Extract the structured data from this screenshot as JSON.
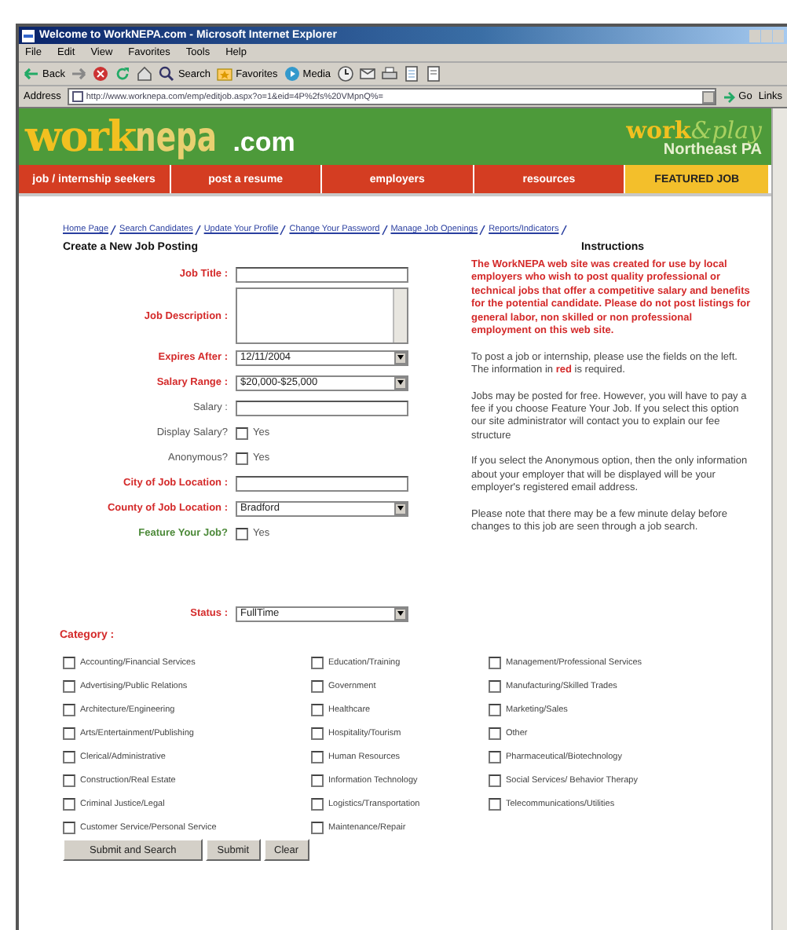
{
  "window": {
    "title": "Welcome to WorkNEPA.com - Microsoft Internet Explorer"
  },
  "menu": [
    "File",
    "Edit",
    "View",
    "Favorites",
    "Tools",
    "Help"
  ],
  "toolbar": [
    {
      "kind": "back",
      "label": "Back"
    },
    {
      "kind": "forward"
    },
    {
      "kind": "stop"
    },
    {
      "kind": "refresh"
    },
    {
      "kind": "home"
    },
    {
      "kind": "search",
      "label": "Search"
    },
    {
      "kind": "favorites",
      "label": "Favorites"
    },
    {
      "kind": "media",
      "label": "Media"
    },
    {
      "kind": "history"
    },
    {
      "kind": "mail"
    },
    {
      "kind": "print"
    },
    {
      "kind": "edit"
    },
    {
      "kind": "discuss"
    }
  ],
  "address": {
    "label": "Address",
    "url": "http://www.worknepa.com/emp/editjob.aspx?o=1&eid=4P%2fs%20VMpnQ%=",
    "go": "Go",
    "links": "Links"
  },
  "banner": {
    "logo_parts": [
      "work",
      "nepa",
      ".com"
    ],
    "side_logo_parts": [
      "work",
      "&play",
      "Northeast PA"
    ]
  },
  "nav": [
    {
      "label": "job / internship seekers",
      "selected": false
    },
    {
      "label": "post a resume",
      "selected": false
    },
    {
      "label": "employers",
      "selected": false
    },
    {
      "label": "resources",
      "selected": false
    },
    {
      "label": "FEATURED JOB",
      "selected": true
    }
  ],
  "breadcrumbs": [
    "Home Page",
    "Search Candidates",
    "Update Your Profile",
    "Change Your Password",
    "Manage Job Openings",
    "Reports/Indicators"
  ],
  "form": {
    "title": "Create a New Job Posting",
    "fields": [
      {
        "label": "Job Title :",
        "kind": "text",
        "required": true
      },
      {
        "label": "Job Description :",
        "kind": "textarea",
        "required": true
      },
      {
        "label": "Expires After :",
        "kind": "select",
        "required": true,
        "value": "12/11/2004"
      },
      {
        "label": "Salary Range :",
        "kind": "select",
        "required": true,
        "value": "$20,000-$25,000"
      },
      {
        "label": "Salary :",
        "kind": "text",
        "required": false,
        "highlighted": false
      },
      {
        "label": "Display Salary?",
        "kind": "checkbox",
        "required": false,
        "highlighted": false,
        "option": "Yes",
        "checked": false
      },
      {
        "label": "Anonymous?",
        "kind": "checkbox",
        "required": false,
        "highlighted": false,
        "option": "Yes",
        "checked": false
      },
      {
        "label": "City of Job Location :",
        "kind": "text",
        "required": true
      },
      {
        "label": "County of Job Location :",
        "kind": "select",
        "required": true,
        "value": "Bradford"
      },
      {
        "label": "Feature Your Job?",
        "kind": "checkbox",
        "required": false,
        "highlighted": true,
        "option": "Yes",
        "checked": false
      },
      {
        "label": "Status :",
        "kind": "select",
        "required": true,
        "value": "FullTime"
      }
    ],
    "category_label": "Category :",
    "categories": [
      [
        {
          "label": "Accounting/Financial Services",
          "checked": false
        },
        {
          "label": "Advertising/Public Relations",
          "checked": false
        },
        {
          "label": "Architecture/Engineering",
          "checked": false
        },
        {
          "label": "Arts/Entertainment/Publishing",
          "checked": false
        },
        {
          "label": "Clerical/Administrative",
          "checked": false
        },
        {
          "label": "Construction/Real Estate",
          "checked": false
        },
        {
          "label": "Criminal Justice/Legal",
          "checked": false
        },
        {
          "label": "Customer Service/Personal Service",
          "checked": false
        }
      ],
      [
        {
          "label": "Education/Training",
          "checked": false
        },
        {
          "label": "Government",
          "checked": false
        },
        {
          "label": "Healthcare",
          "checked": false
        },
        {
          "label": "Hospitality/Tourism",
          "checked": false
        },
        {
          "label": "Human Resources",
          "checked": false
        },
        {
          "label": "Information Technology",
          "checked": false
        },
        {
          "label": "Logistics/Transportation",
          "checked": false
        },
        {
          "label": "Maintenance/Repair",
          "checked": false
        }
      ],
      [
        {
          "label": "Management/Professional Services",
          "checked": false
        },
        {
          "label": "Manufacturing/Skilled Trades",
          "checked": false
        },
        {
          "label": "Marketing/Sales",
          "checked": false
        },
        {
          "label": "Other",
          "checked": false
        },
        {
          "label": "Pharmaceutical/Biotechnology",
          "checked": false
        },
        {
          "label": "Social Services/ Behavior Therapy",
          "checked": false
        },
        {
          "label": "Telecommunications/Utilities",
          "checked": false
        }
      ]
    ],
    "buttons": [
      "Submit and Search",
      "Submit",
      "Clear"
    ]
  },
  "instructions": {
    "title": "Instructions",
    "paragraphs": [
      {
        "kind": "warning",
        "text": "The WorkNEPA web site was created for use by local employers who wish to post quality professional or technical jobs that offer a competitive salary and benefits for the potential candidate. Please do not post listings for general labor, non skilled or non professional employment on this web site."
      },
      {
        "kind": "normal",
        "text": "To post a job or internship, please use the fields on the left. The information in **red** is required."
      },
      {
        "kind": "normal",
        "text": "Jobs may be posted for free.  However, you will have to pay a fee if you choose Feature Your Job. If you select this option our site administrator will contact you to explain our fee structure"
      },
      {
        "kind": "normal",
        "text": "If you select the Anonymous option, then the only information about your employer that will be displayed will be your employer's registered email address."
      },
      {
        "kind": "normal",
        "text": "Please note that there may be a few minute delay before changes to this job are seen through a job search."
      }
    ]
  }
}
